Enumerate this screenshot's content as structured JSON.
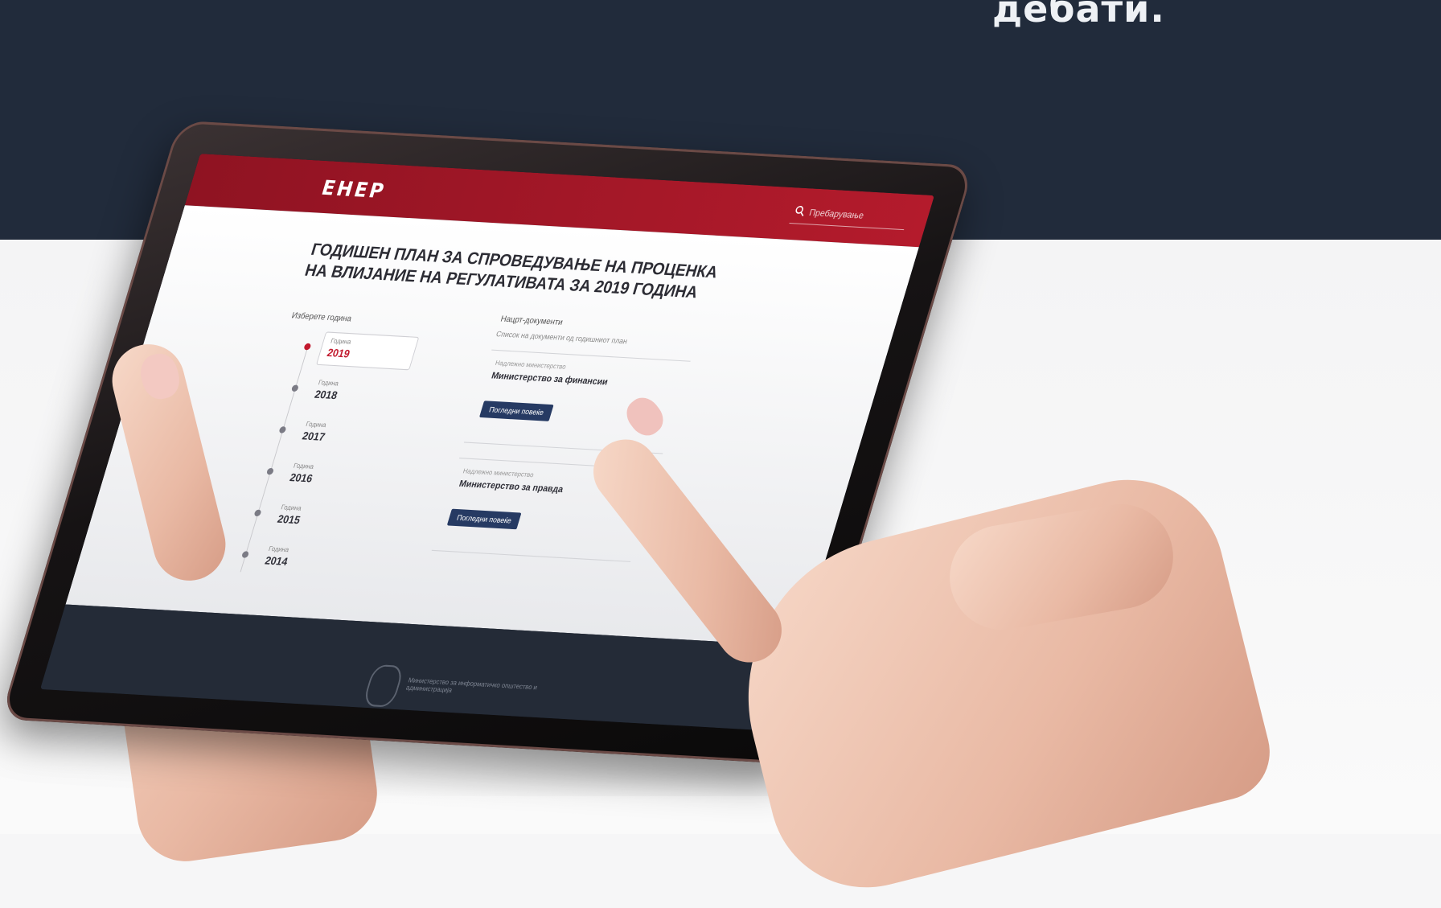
{
  "hero": {
    "caption": "дебати."
  },
  "tablet_app": {
    "logo": "ЕНЕР",
    "search_placeholder": "Пребарување",
    "page_title": "ГОДИШЕН ПЛАН ЗА СПРОВЕДУВАЊЕ НА ПРОЦЕНКА НА ВЛИЈАНИЕ НА РЕГУЛАТИВАТА ЗА 2019 ГОДИНА",
    "left_label": "Изберете година",
    "right_label": "Нацрт-документи",
    "right_sub": "Список на документи од годишниот план",
    "timeline": [
      {
        "small": "Година",
        "year": "2019"
      },
      {
        "small": "Година",
        "year": "2018"
      },
      {
        "small": "Година",
        "year": "2017"
      },
      {
        "small": "Година",
        "year": "2016"
      },
      {
        "small": "Година",
        "year": "2015"
      },
      {
        "small": "Година",
        "year": "2014"
      }
    ],
    "documents": [
      {
        "meta": "Надлежно министерство",
        "name": "Министерство за финансии",
        "button": "Погледни повеќе"
      },
      {
        "meta": "Надлежно министерство",
        "name": "Министерство за правда",
        "button": "Погледни повеќе"
      }
    ],
    "footer_text": "Министерство за информатичко општество и администрација"
  },
  "colors": {
    "hero_background": "#212b3b",
    "app_header": "#b41b2c",
    "button": "#263a63"
  }
}
